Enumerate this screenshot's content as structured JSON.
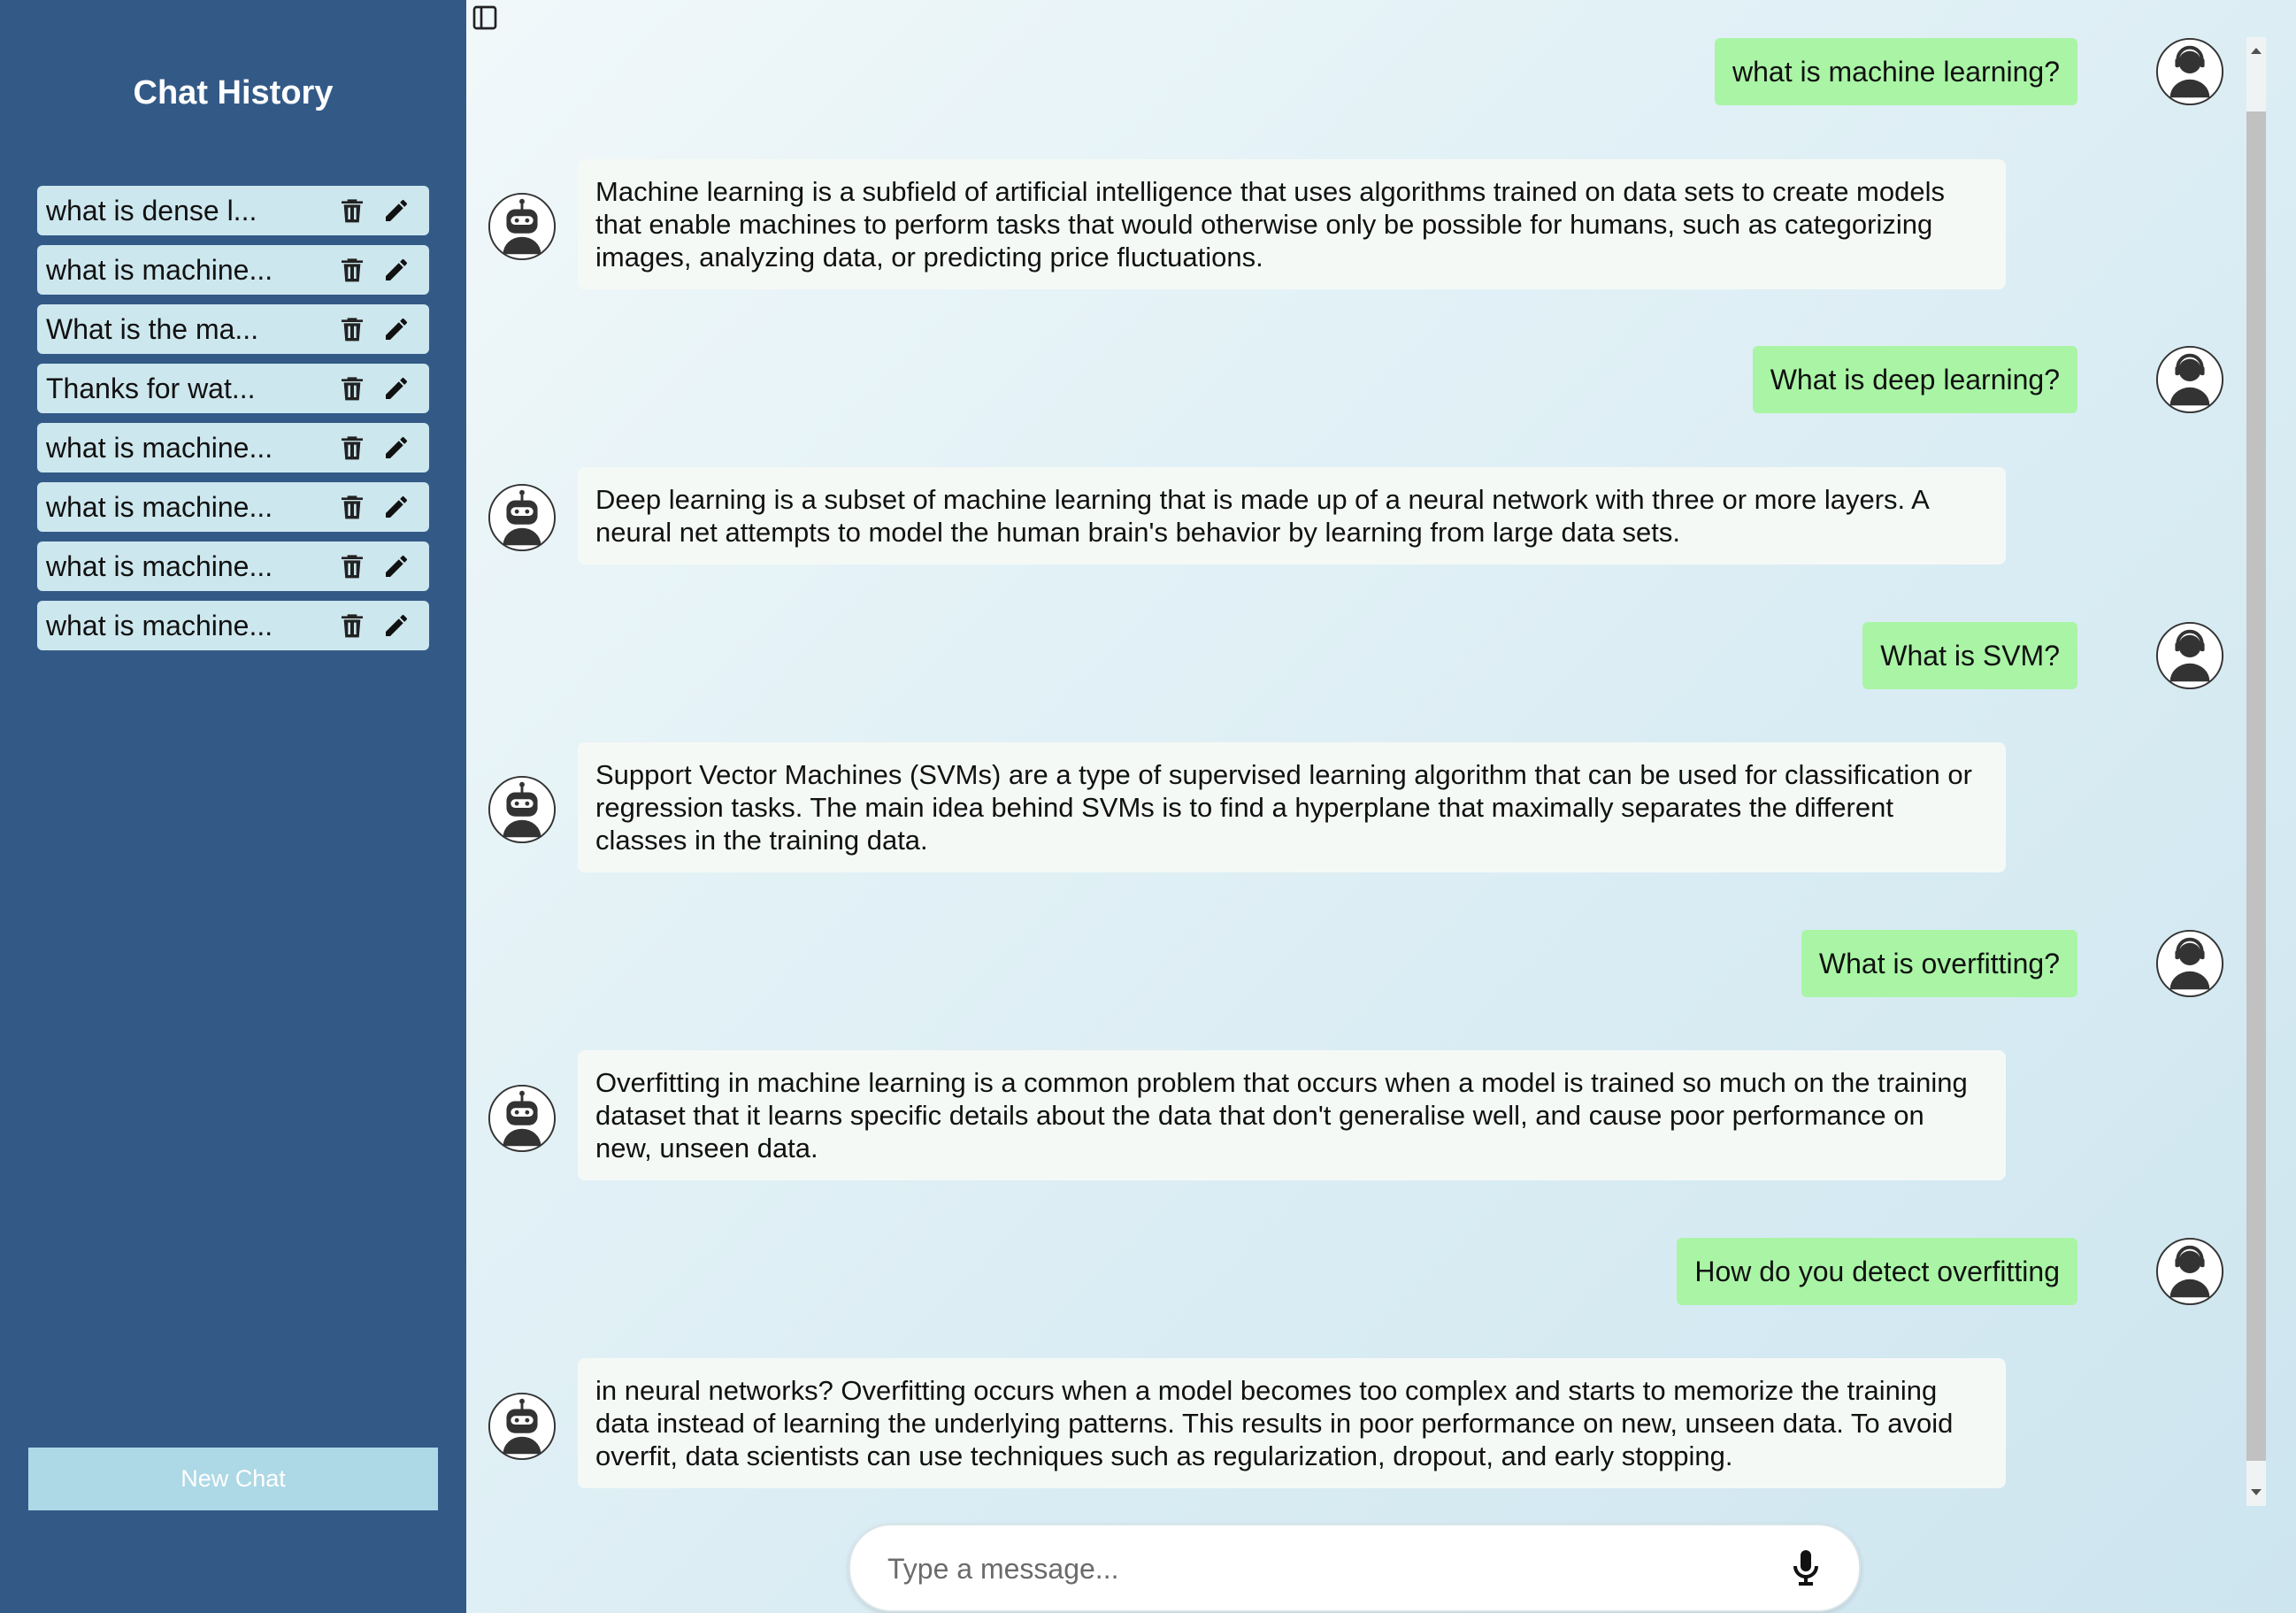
{
  "sidebar": {
    "title": "Chat History",
    "items": [
      {
        "label": "what is dense l..."
      },
      {
        "label": "what is machine..."
      },
      {
        "label": "What is the ma..."
      },
      {
        "label": "Thanks for wat..."
      },
      {
        "label": "what is machine..."
      },
      {
        "label": "what is machine..."
      },
      {
        "label": "what is machine..."
      },
      {
        "label": "what is machine..."
      }
    ],
    "item_icons": [
      "trash-icon",
      "pencil-icon"
    ],
    "new_chat_label": "New Chat"
  },
  "chat": {
    "messages": [
      {
        "role": "user",
        "text": "what is machine learning?"
      },
      {
        "role": "bot",
        "text": "Machine learning is a subfield of artificial intelligence that uses algorithms trained on data sets to create models that enable machines to perform tasks that would otherwise only be possible for humans, such as categorizing images, analyzing data, or predicting price fluctuations."
      },
      {
        "role": "user",
        "text": "What is deep learning?"
      },
      {
        "role": "bot",
        "text": "Deep learning is a subset of machine learning that is made up of a neural network with three or more layers. A neural net attempts to model the human brain's behavior by learning from large data sets."
      },
      {
        "role": "user",
        "text": "What is SVM?"
      },
      {
        "role": "bot",
        "text": "Support Vector Machines (SVMs) are a type of supervised learning algorithm that can be used for classification or regression tasks. The main idea behind SVMs is to find a hyperplane that maximally separates the different classes in the training data."
      },
      {
        "role": "user",
        "text": "What is overfitting?"
      },
      {
        "role": "bot",
        "text": "Overfitting in machine learning is a common problem that occurs when a model is trained so much on the training dataset that it learns specific details about the data that don't generalise well, and cause poor performance on new, unseen data."
      },
      {
        "role": "user",
        "text": "How do you detect overfitting"
      },
      {
        "role": "bot",
        "text": "in neural networks? Overfitting occurs when a model becomes too complex and starts to memorize the training data instead of learning the underlying patterns. This results in poor performance on new, unseen data. To avoid overfit, data scientists can use techniques such as regularization, dropout, and early stopping."
      }
    ],
    "avatars": {
      "user": "user-headset-icon",
      "bot": "robot-icon"
    }
  },
  "input": {
    "placeholder": "Type a message...",
    "value": "",
    "mic_icon": "microphone-icon"
  },
  "colors": {
    "sidebar_bg": "#335a87",
    "history_item_bg": "#cde7ee",
    "new_chat_bg": "#add8e6",
    "user_bubble": "#a9f5a5",
    "bot_bubble": "#f5f9f6"
  }
}
